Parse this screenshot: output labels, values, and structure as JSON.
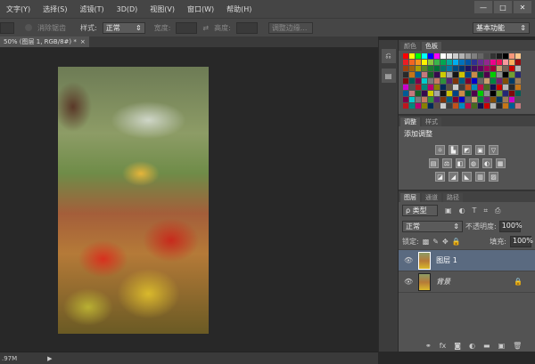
{
  "menu": [
    "文字(Y)",
    "选择(S)",
    "滤镜(T)",
    "3D(D)",
    "视图(V)",
    "窗口(W)",
    "帮助(H)"
  ],
  "window_controls": {
    "minimize": "—",
    "maximize": "□",
    "close": "✕"
  },
  "options": {
    "antialias": "消除锯齿",
    "style_label": "样式:",
    "style_value": "正常",
    "width_label": "宽度:",
    "height_label": "高度:",
    "refine_edge": "调整边缘...",
    "workspace": "基本功能"
  },
  "document_tab": {
    "title": "50% (图层 1, RGB/8#) *",
    "close": "×"
  },
  "swatch_panel": {
    "tabs": [
      "颜色",
      "色板"
    ]
  },
  "swatch_colors": [
    "#ff0000",
    "#ffff00",
    "#00ff00",
    "#00ffff",
    "#0000ff",
    "#ff00ff",
    "#ffffff",
    "#e6e6e6",
    "#cccccc",
    "#b3b3b3",
    "#999999",
    "#808080",
    "#666666",
    "#4d4d4d",
    "#333333",
    "#1a1a1a",
    "#000000",
    "#f7977a",
    "#fdc68a",
    "#ed1c24",
    "#f26522",
    "#f7941d",
    "#fff200",
    "#8dc63f",
    "#39b54a",
    "#00a651",
    "#00a99d",
    "#00aeef",
    "#0072bc",
    "#0054a6",
    "#2e3192",
    "#662d91",
    "#92278f",
    "#ec008c",
    "#ed145b",
    "#f5989d",
    "#fbaf5d",
    "#9e0b0f",
    "#a0410d",
    "#a36209",
    "#aba000",
    "#598527",
    "#1a7b30",
    "#007236",
    "#00746b",
    "#0076a3",
    "#004a80",
    "#003471",
    "#1b1464",
    "#440e62",
    "#630460",
    "#9e005d",
    "#9e0039",
    "#c69c6d",
    "#736357"
  ],
  "adjustments_panel": {
    "tabs": [
      "调整",
      "样式"
    ],
    "heading": "添加调整",
    "rows": [
      [
        "☼",
        "▙",
        "◩",
        "▣",
        "▽"
      ],
      [
        "▤",
        "⚖",
        "◧",
        "◍",
        "◐",
        "▦"
      ],
      [
        "◪",
        "◢",
        "◣",
        "▥",
        "▨"
      ]
    ]
  },
  "layers_panel": {
    "tabs": [
      "图层",
      "通道",
      "路径"
    ],
    "filter_kind": "ρ 类型",
    "blend_mode": "正常",
    "opacity_label": "不透明度:",
    "opacity": "100%",
    "lock_label": "锁定:",
    "fill_label": "填充:",
    "fill": "100%",
    "layers": [
      {
        "name": "图层 1",
        "selected": true,
        "locked": false
      },
      {
        "name": "背景",
        "selected": false,
        "locked": true
      }
    ],
    "footer_icons": [
      "⚭",
      "fx",
      "◙",
      "◐",
      "▬",
      "▣",
      "🗑"
    ]
  },
  "status": {
    "doc_size": ".97M",
    "arrow": "▶"
  }
}
